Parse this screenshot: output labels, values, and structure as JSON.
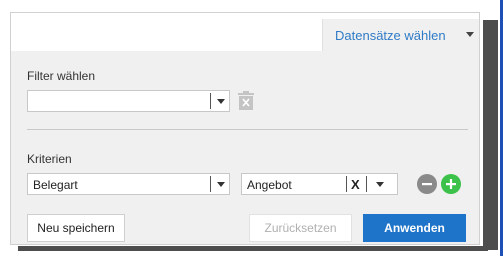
{
  "header": {
    "dropdown_label": "Datensätze wählen"
  },
  "filter": {
    "label": "Filter wählen",
    "value": ""
  },
  "criteria": {
    "label": "Kriterien",
    "field_value": "Belegart",
    "operand_value": "Angebot",
    "clear_symbol": "X"
  },
  "actions": {
    "save_label": "Neu speichern",
    "reset_label": "Zurücksetzen",
    "apply_label": "Anwenden"
  },
  "colors": {
    "link_blue": "#2f7bc7",
    "primary_button": "#1e74c8",
    "add_green": "#3cc24a",
    "remove_gray": "#8a8a8a"
  }
}
